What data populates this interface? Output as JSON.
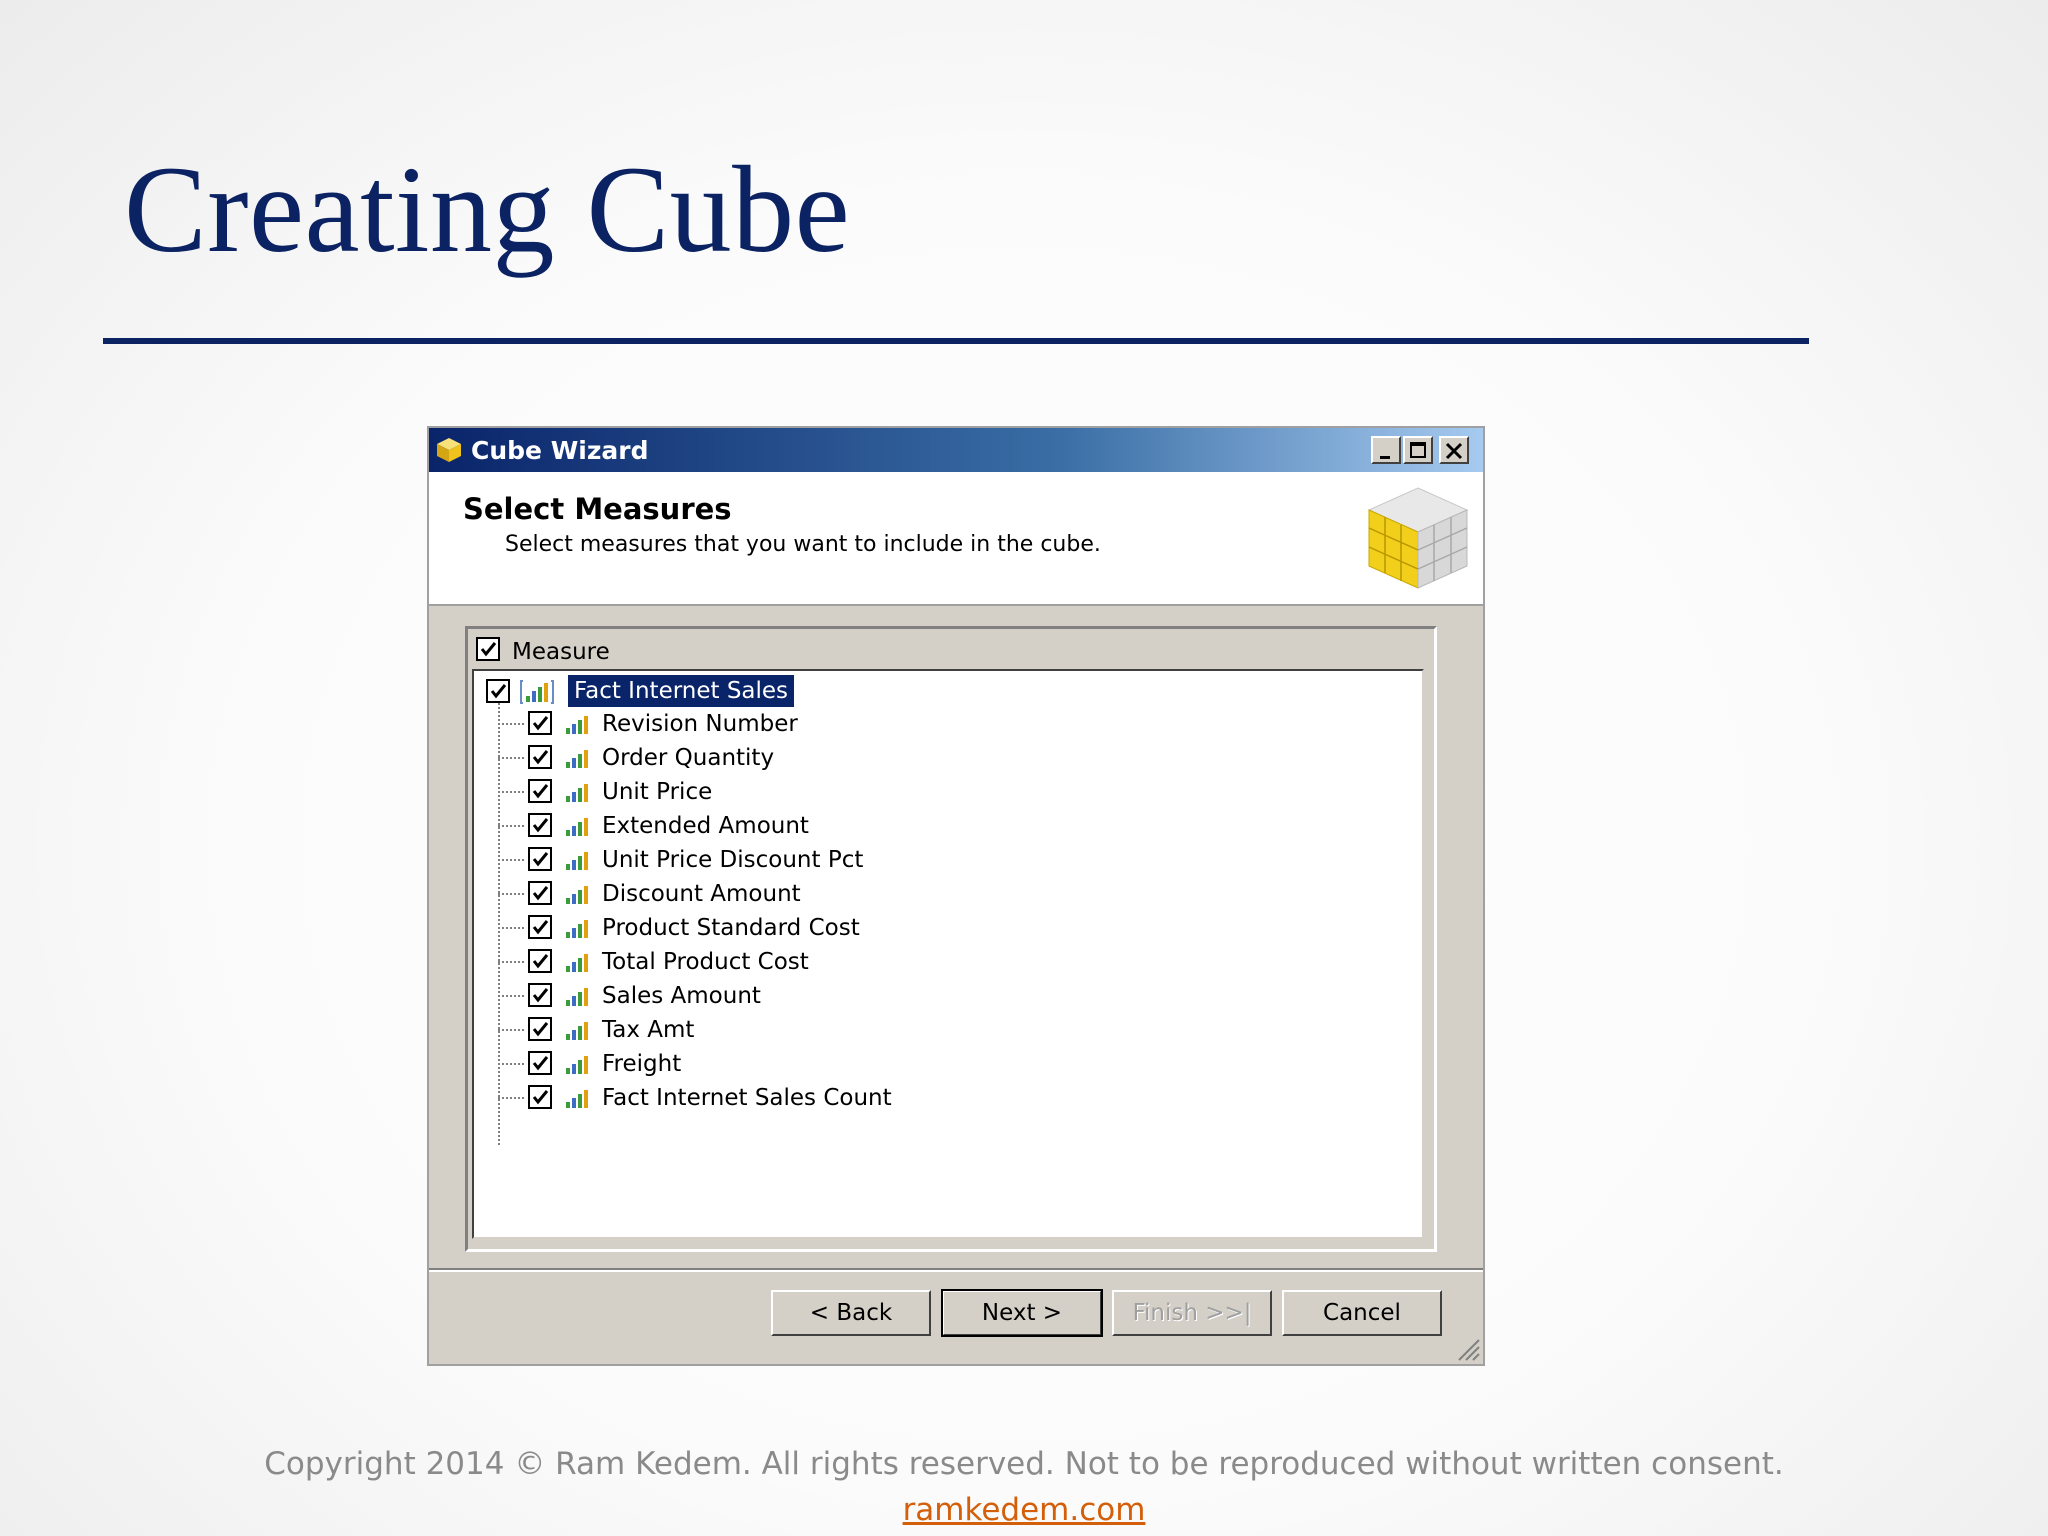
{
  "slide": {
    "title": "Creating Cube",
    "copyright": "Copyright 2014 © Ram Kedem. All rights reserved. Not to be reproduced without written consent.",
    "link": "ramkedem.com"
  },
  "dialog": {
    "title": "Cube Wizard",
    "header_title": "Select Measures",
    "header_subtitle": "Select measures that you want to include in the cube.",
    "group_header": "Measure",
    "root": "Fact Internet Sales",
    "measures": [
      "Revision Number",
      "Order Quantity",
      "Unit Price",
      "Extended Amount",
      "Unit Price Discount Pct",
      "Discount Amount",
      "Product Standard Cost",
      "Total Product Cost",
      "Sales Amount",
      "Tax Amt",
      "Freight",
      "Fact Internet Sales Count"
    ],
    "buttons": {
      "back": "< Back",
      "next": "Next >",
      "finish": "Finish >>|",
      "cancel": "Cancel"
    }
  },
  "colors": {
    "title": "#0b2263",
    "titlebar_start": "#0a246a",
    "selection": "#0a246a",
    "link": "#d35f0b"
  }
}
